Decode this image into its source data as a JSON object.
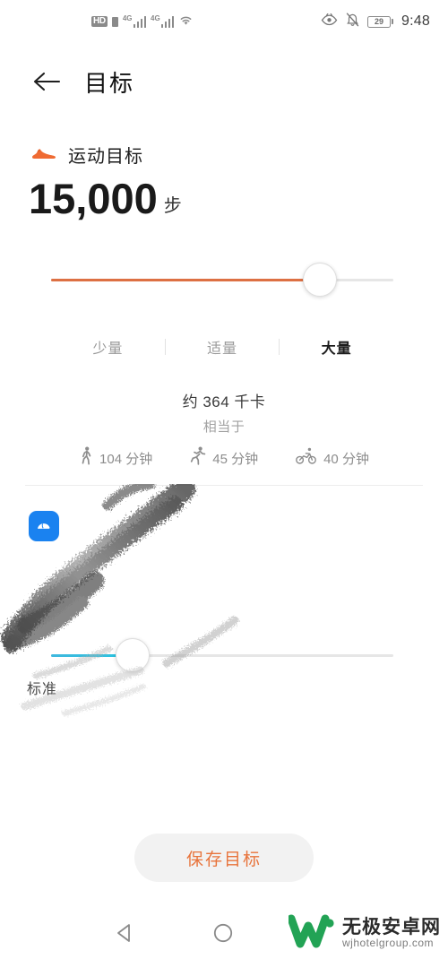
{
  "statusbar": {
    "hd_badge": "HD",
    "network_1": "4G",
    "network_2": "4G",
    "battery_level": "29",
    "time": "9:48",
    "icons": [
      "hd-icon",
      "sim-icon",
      "signal-icon",
      "signal-icon",
      "wifi-icon",
      "eye-icon",
      "mute-icon",
      "battery-icon"
    ]
  },
  "header": {
    "back_icon": "back-arrow-icon",
    "title": "目标"
  },
  "exercise": {
    "icon": "running-shoe-icon",
    "section_label": "运动目标",
    "value": "15,000",
    "unit": "步",
    "slider": {
      "percent": 78,
      "fill_color": "#dd7043"
    },
    "segments": [
      {
        "label": "少量",
        "active": false
      },
      {
        "label": "适量",
        "active": false
      },
      {
        "label": "大量",
        "active": true
      }
    ],
    "calories_main": "约 364 千卡",
    "calories_sub": "相当于",
    "equivalents": [
      {
        "icon": "walking-icon",
        "text": "104 分钟"
      },
      {
        "icon": "running-icon",
        "text": "45 分钟"
      },
      {
        "icon": "cycling-icon",
        "text": "40 分钟"
      }
    ]
  },
  "sleep": {
    "icon": "sleep-icon",
    "section_label": "",
    "value": "",
    "unit": "",
    "slider": {
      "percent": 22,
      "fill_color": "#28c4e0"
    },
    "segment_label": "标准",
    "obscured": true
  },
  "save": {
    "label": "保存目标",
    "text_color": "#e8743c",
    "background": "#f2f2f2"
  },
  "navbar": {
    "back_icon": "nav-back-triangle-icon",
    "home_icon": "nav-home-circle-icon"
  },
  "watermark": {
    "logo_icon": "w-logo-icon",
    "title_cn": "无极安卓网",
    "url": "wjhotelgroup.com",
    "logo_color": "#22a355"
  }
}
